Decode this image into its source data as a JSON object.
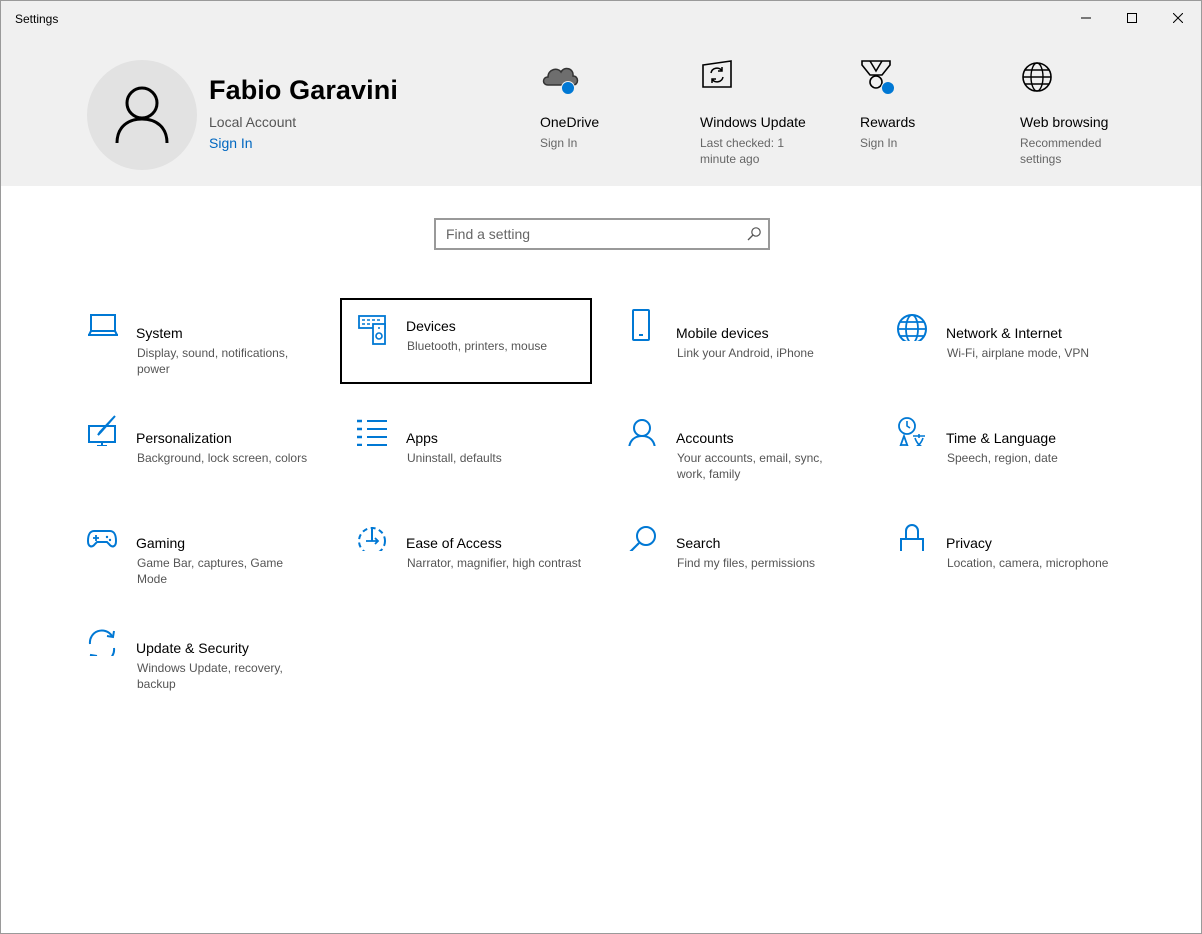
{
  "window": {
    "title": "Settings"
  },
  "account": {
    "name": "Fabio Garavini",
    "type": "Local Account",
    "sign_in": "Sign In"
  },
  "quick_links": [
    {
      "title": "OneDrive",
      "subtitle": "Sign In",
      "icon": "onedrive-cloud-icon",
      "badge": true
    },
    {
      "title": "Windows Update",
      "subtitle": "Last checked: 1 minute ago",
      "icon": "windows-update-icon",
      "badge": false
    },
    {
      "title": "Rewards",
      "subtitle": "Sign In",
      "icon": "rewards-medal-icon",
      "badge": true
    },
    {
      "title": "Web browsing",
      "subtitle": "Recommended settings",
      "icon": "globe-icon",
      "badge": false
    }
  ],
  "search": {
    "placeholder": "Find a setting",
    "value": ""
  },
  "categories": [
    {
      "title": "System",
      "description": "Display, sound, notifications, power",
      "icon": "laptop-icon"
    },
    {
      "title": "Devices",
      "description": "Bluetooth, printers, mouse",
      "icon": "keyboard-speaker-icon",
      "focused": true
    },
    {
      "title": "Mobile devices",
      "description": "Link your Android, iPhone",
      "icon": "phone-icon"
    },
    {
      "title": "Network & Internet",
      "description": "Wi-Fi, airplane mode, VPN",
      "icon": "globe-icon"
    },
    {
      "title": "Personalization",
      "description": "Background, lock screen, colors",
      "icon": "paint-monitor-icon"
    },
    {
      "title": "Apps",
      "description": "Uninstall, defaults",
      "icon": "apps-list-icon"
    },
    {
      "title": "Accounts",
      "description": "Your accounts, email, sync, work, family",
      "icon": "person-icon"
    },
    {
      "title": "Time & Language",
      "description": "Speech, region, date",
      "icon": "time-language-icon"
    },
    {
      "title": "Gaming",
      "description": "Game Bar, captures, Game Mode",
      "icon": "gamepad-icon"
    },
    {
      "title": "Ease of Access",
      "description": "Narrator, magnifier, high contrast",
      "icon": "ease-of-access-icon"
    },
    {
      "title": "Search",
      "description": "Find my files, permissions",
      "icon": "magnifier-icon"
    },
    {
      "title": "Privacy",
      "description": "Location, camera, microphone",
      "icon": "padlock-icon"
    },
    {
      "title": "Update & Security",
      "description": "Windows Update, recovery, backup",
      "icon": "sync-arrows-icon"
    }
  ],
  "colors": {
    "accent": "#0078d4",
    "link": "#0067c0",
    "header_bg": "#f0f0f0"
  }
}
